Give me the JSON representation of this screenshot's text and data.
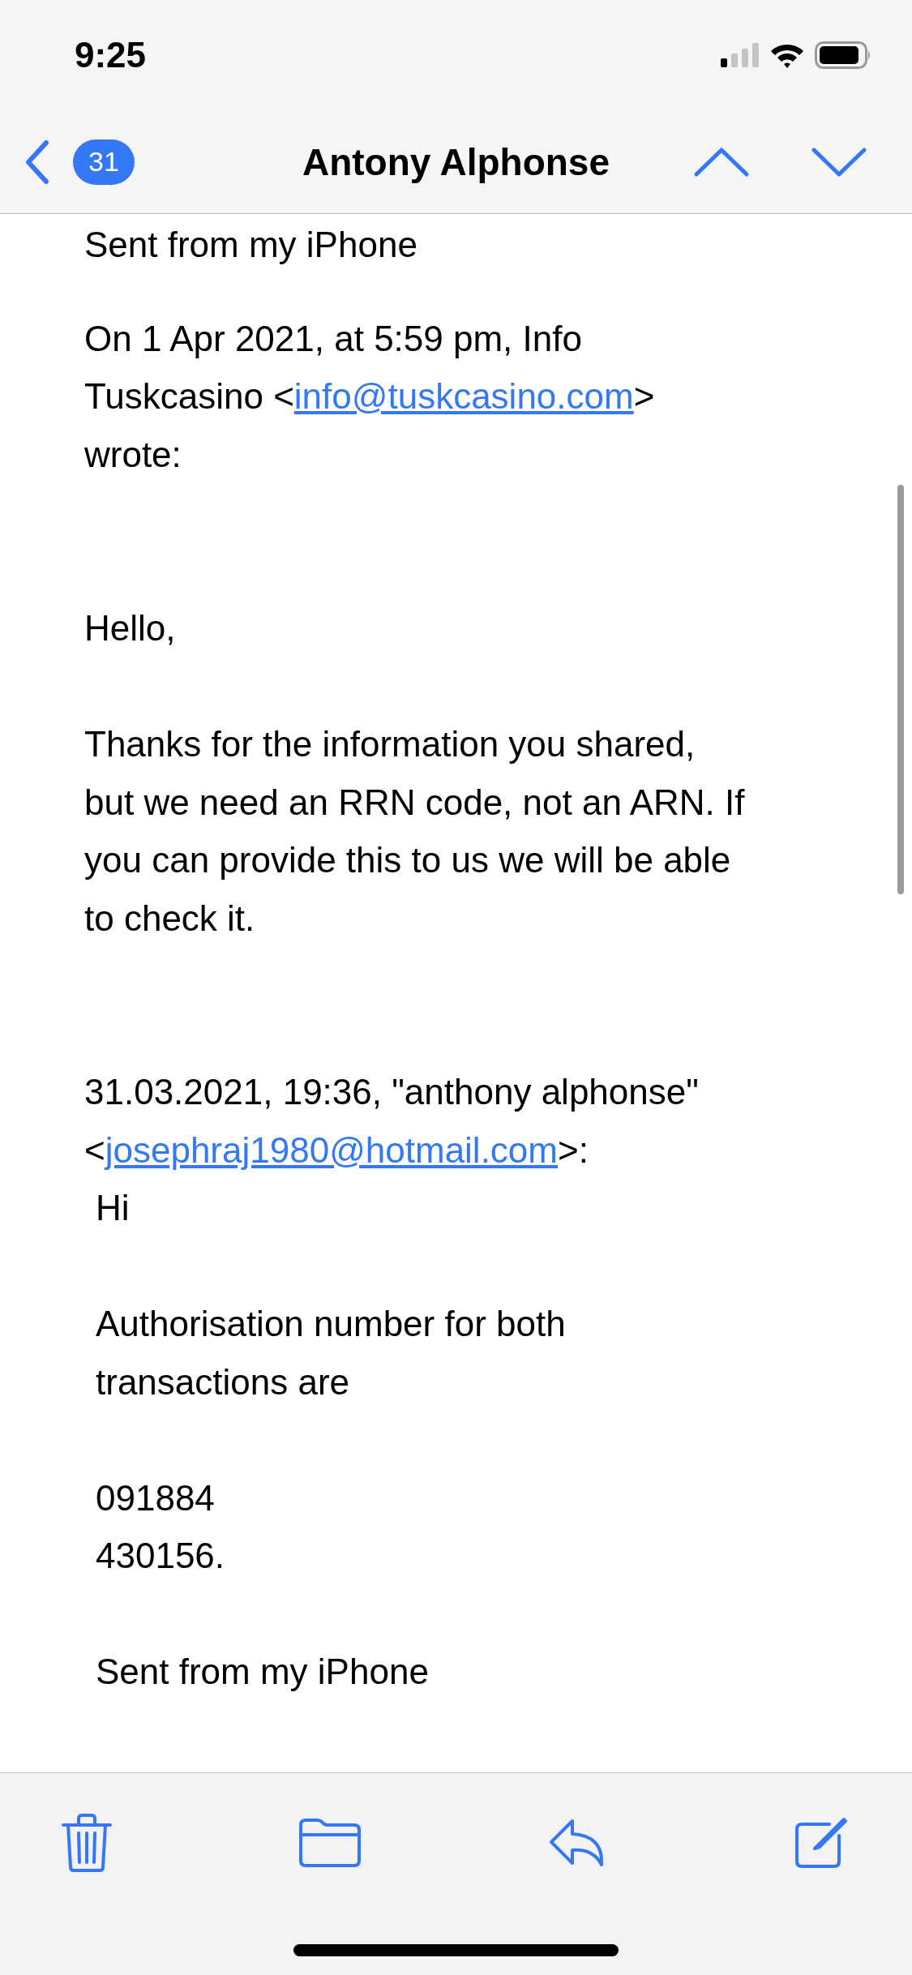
{
  "status_bar": {
    "time": "9:25"
  },
  "nav_bar": {
    "unread_count": "31",
    "title": "Antony Alphonse"
  },
  "message": {
    "blocks": [
      {
        "lines": [
          [
            {
              "text": "Sent from my iPhone"
            }
          ]
        ]
      },
      {
        "lines": [
          [
            {
              "text": "On 1 Apr 2021, at 5:59 pm, Info"
            }
          ],
          [
            {
              "text": "Tuskcasino <"
            },
            {
              "link": "info@tuskcasino.com"
            },
            {
              "text": ">"
            }
          ],
          [
            {
              "text": "wrote:"
            }
          ]
        ]
      },
      {
        "lines": [
          [
            {
              "text": "Hello,"
            }
          ]
        ]
      },
      {
        "lines": [
          [
            {
              "text": "Thanks for the information you shared,"
            }
          ],
          [
            {
              "text": "but we need an RRN code, not an ARN. If"
            }
          ],
          [
            {
              "text": "you can provide this to us we will be able"
            }
          ],
          [
            {
              "text": "to check it."
            }
          ]
        ]
      },
      {
        "lines": [
          [
            {
              "text": "31.03.2021, 19:36, \"anthony alphonse\""
            }
          ],
          [
            {
              "text": "<"
            },
            {
              "link": "josephraj1980@hotmail.com"
            },
            {
              "text": ">:"
            }
          ]
        ]
      }
    ],
    "quoted_blocks": [
      {
        "lines": [
          [
            {
              "text": "Hi"
            }
          ]
        ]
      },
      {
        "lines": [
          [
            {
              "text": "Authorisation number for both"
            }
          ],
          [
            {
              "text": "transactions are"
            }
          ]
        ]
      },
      {
        "lines": [
          [
            {
              "text": "091884"
            }
          ],
          [
            {
              "text": "430156."
            }
          ]
        ]
      },
      {
        "lines": [
          [
            {
              "text": "Sent from my iPhone"
            }
          ]
        ]
      }
    ]
  }
}
